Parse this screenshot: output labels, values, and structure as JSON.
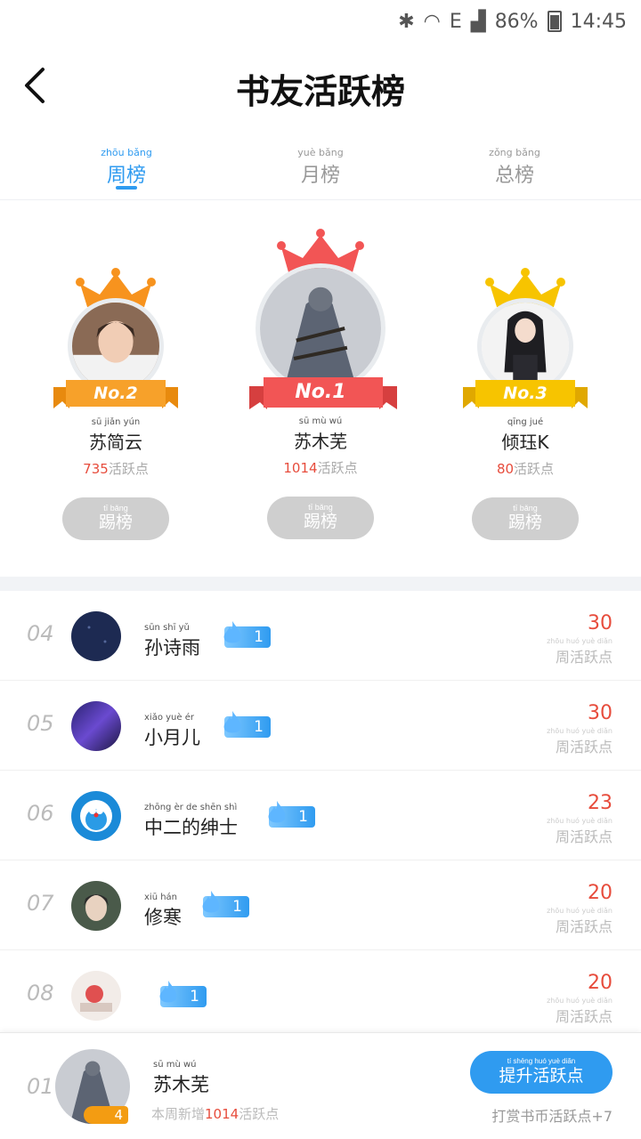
{
  "status": {
    "battery": "86%",
    "time": "14:45",
    "net": "E"
  },
  "header": {
    "title": "书友活跃榜"
  },
  "tabs": [
    {
      "py": "zhōu bǎng",
      "label": "周榜"
    },
    {
      "py": "yuè bǎng",
      "label": "月榜"
    },
    {
      "py": "zǒng bǎng",
      "label": "总榜"
    }
  ],
  "podium": {
    "first": {
      "rank_label": "No.1",
      "name_py": "sū mù wú",
      "name": "苏木芜",
      "score": "1014",
      "score_label": "活跃点"
    },
    "second": {
      "rank_label": "No.2",
      "name_py": "sū jiǎn yún",
      "name": "苏简云",
      "score": "735",
      "score_label": "活跃点"
    },
    "third": {
      "rank_label": "No.3",
      "name_py": "qīng jué",
      "name": "倾珏K",
      "score": "80",
      "score_label": "活跃点"
    },
    "kick_py": "tī bǎng",
    "kick_label": "踢榜"
  },
  "list": [
    {
      "rank": "04",
      "name_py": "sūn shī yǔ",
      "name": "孙诗雨",
      "level": "1",
      "score": "30",
      "label_py": "zhōu huó yuè diǎn",
      "label": "周活跃点"
    },
    {
      "rank": "05",
      "name_py": "xiǎo yuè ér",
      "name": "小月儿",
      "level": "1",
      "score": "30",
      "label_py": "zhōu huó yuè diǎn",
      "label": "周活跃点"
    },
    {
      "rank": "06",
      "name_py": "zhōng èr de shēn shì",
      "name": "中二的绅士",
      "level": "1",
      "score": "23",
      "label_py": "zhōu huó yuè diǎn",
      "label": "周活跃点"
    },
    {
      "rank": "07",
      "name_py": "xiū hán",
      "name": "修寒",
      "level": "1",
      "score": "20",
      "label_py": "zhōu huó yuè diǎn",
      "label": "周活跃点"
    },
    {
      "rank": "08",
      "name_py": "",
      "name": "",
      "level": "1",
      "score": "20",
      "label_py": "zhōu huó yuè diǎn",
      "label": "周活跃点"
    }
  ],
  "me": {
    "rank": "01",
    "level": "4",
    "name_py": "sū mù wú",
    "name": "苏木芜",
    "sub_prefix": "本周新增",
    "sub_num": "1014",
    "sub_suffix": "活跃点",
    "button_py": "tí shēng huó yuè diǎn",
    "button": "提升活跃点",
    "note": "打赏书币活跃点+7"
  },
  "colors": {
    "accent": "#2f9bf0",
    "score": "#e74c3c",
    "gold": "#f7b500",
    "silver_crown": "#f39c12",
    "crown_red": "#f25555"
  }
}
